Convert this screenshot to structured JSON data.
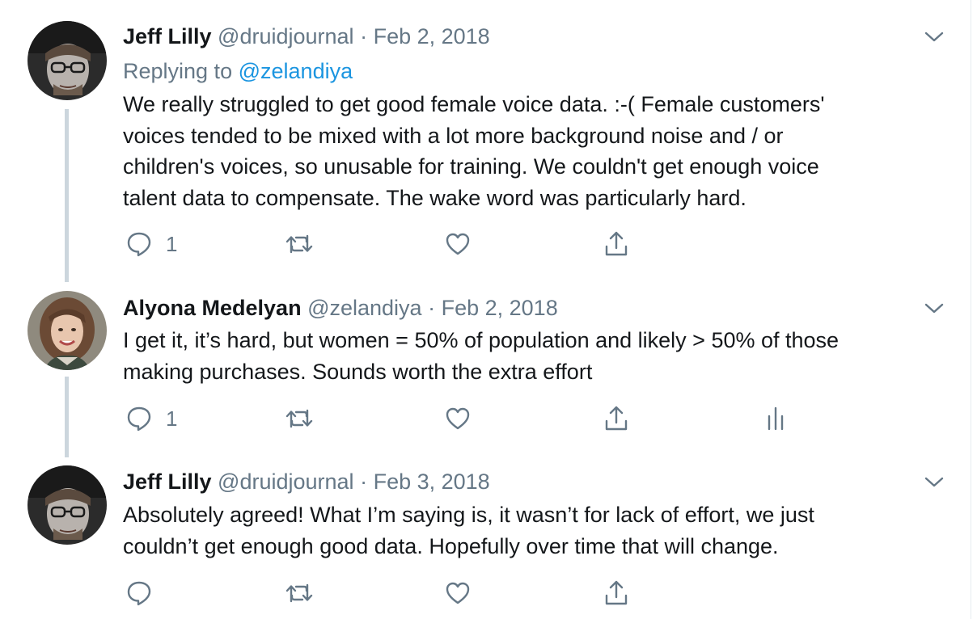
{
  "tweets": [
    {
      "name": "Jeff Lilly",
      "handle": "@druidjournal",
      "sep": "·",
      "date": "Feb 2, 2018",
      "reply_prefix": "Replying to",
      "reply_handle": "@zelandiya",
      "lines": [
        "We really struggled to get good female voice data. :-( Female customers'",
        "voices tended to be mixed with a lot more background noise and / or",
        "children's voices, so unusable for training. We couldn't get enough voice",
        "talent data to compensate. The wake word was particularly hard."
      ],
      "reply_count": "1",
      "avatar_icon": "man-with-glasses-avatar"
    },
    {
      "name": "Alyona Medelyan",
      "handle": "@zelandiya",
      "sep": "·",
      "date": "Feb 2, 2018",
      "lines": [
        "I get it, it’s hard, but women = 50% of population and likely > 50% of those",
        "making purchases. Sounds worth the extra effort"
      ],
      "reply_count": "1",
      "avatar_icon": "woman-smiling-avatar"
    },
    {
      "name": "Jeff Lilly",
      "handle": "@druidjournal",
      "sep": "·",
      "date": "Feb 3, 2018",
      "lines": [
        "Absolutely agreed! What I’m saying is, it wasn’t for lack of effort, we just",
        "couldn’t get enough good data. Hopefully over time that will change."
      ],
      "reply_count": "",
      "avatar_icon": "man-with-glasses-avatar"
    }
  ],
  "colors": {
    "text": "#14171a",
    "muted": "#657786",
    "link": "#1b95e0",
    "thread_line": "#ccd6dd"
  },
  "icons": {
    "reply": "reply-icon",
    "retweet": "retweet-icon",
    "like": "heart-icon",
    "share": "share-icon",
    "analytics": "analytics-icon",
    "more": "chevron-down-icon"
  }
}
